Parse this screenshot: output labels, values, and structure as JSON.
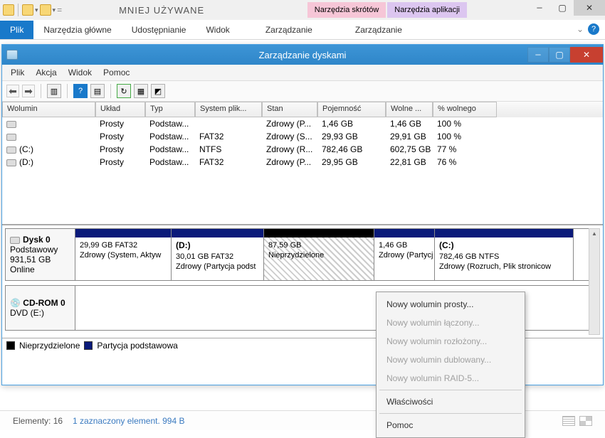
{
  "outer": {
    "title": "MNIEJ UŻYWANE",
    "ctx_tabs": [
      "Narzędzia skrótów",
      "Narzędzia aplikacji"
    ],
    "ribbon": [
      "Plik",
      "Narzędzia główne",
      "Udostępnianie",
      "Widok",
      "Zarządzanie",
      "Zarządzanie"
    ]
  },
  "dm": {
    "title": "Zarządzanie dyskami",
    "menu": [
      "Plik",
      "Akcja",
      "Widok",
      "Pomoc"
    ],
    "columns": [
      "Wolumin",
      "Układ",
      "Typ",
      "System plik...",
      "Stan",
      "Pojemność",
      "Wolne ...",
      "% wolnego"
    ],
    "rows": [
      {
        "name": "",
        "layout": "Prosty",
        "type": "Podstaw...",
        "fs": "",
        "state": "Zdrowy (P...",
        "cap": "1,46 GB",
        "free": "1,46 GB",
        "pct": "100 %"
      },
      {
        "name": "",
        "layout": "Prosty",
        "type": "Podstaw...",
        "fs": "FAT32",
        "state": "Zdrowy (S...",
        "cap": "29,93 GB",
        "free": "29,91 GB",
        "pct": "100 %"
      },
      {
        "name": "(C:)",
        "layout": "Prosty",
        "type": "Podstaw...",
        "fs": "NTFS",
        "state": "Zdrowy (R...",
        "cap": "782,46 GB",
        "free": "602,75 GB",
        "pct": "77 %"
      },
      {
        "name": "(D:)",
        "layout": "Prosty",
        "type": "Podstaw...",
        "fs": "FAT32",
        "state": "Zdrowy (P...",
        "cap": "29,95 GB",
        "free": "22,81 GB",
        "pct": "76 %"
      }
    ],
    "disk0": {
      "label": "Dysk 0",
      "kind": "Podstawowy",
      "size": "931,51 GB",
      "status": "Online",
      "parts": [
        {
          "title": "",
          "sub": "29,99 GB FAT32",
          "state": "Zdrowy (System, Aktyw",
          "w": 135,
          "unalloc": false
        },
        {
          "title": "(D:)",
          "sub": "30,01 GB FAT32",
          "state": "Zdrowy (Partycja podst",
          "w": 130,
          "unalloc": false
        },
        {
          "title": "",
          "sub": "87,59 GB",
          "state": "Nieprzydzielone",
          "w": 155,
          "unalloc": true
        },
        {
          "title": "",
          "sub": "1,46 GB",
          "state": "Zdrowy (Partycj",
          "w": 85,
          "unalloc": false
        },
        {
          "title": "(C:)",
          "sub": "782,46 GB NTFS",
          "state": "Zdrowy (Rozruch, Plik stronicow",
          "w": 195,
          "unalloc": false
        }
      ]
    },
    "cdrom": {
      "label": "CD-ROM 0",
      "kind": "DVD (E:)"
    },
    "legend": {
      "unalloc": "Nieprzydzielone",
      "primary": "Partycja podstawowa"
    }
  },
  "ctx": {
    "items": [
      {
        "t": "Nowy wolumin prosty...",
        "en": true
      },
      {
        "t": "Nowy wolumin łączony...",
        "en": false
      },
      {
        "t": "Nowy wolumin rozłożony...",
        "en": false
      },
      {
        "t": "Nowy wolumin dublowany...",
        "en": false
      },
      {
        "t": "Nowy wolumin RAID-5...",
        "en": false
      },
      {
        "t": "Właściwości",
        "en": true
      },
      {
        "t": "Pomoc",
        "en": true
      }
    ]
  },
  "status": {
    "a": "Elementy: 16",
    "b": "1 zaznaczony element. 994 B"
  }
}
